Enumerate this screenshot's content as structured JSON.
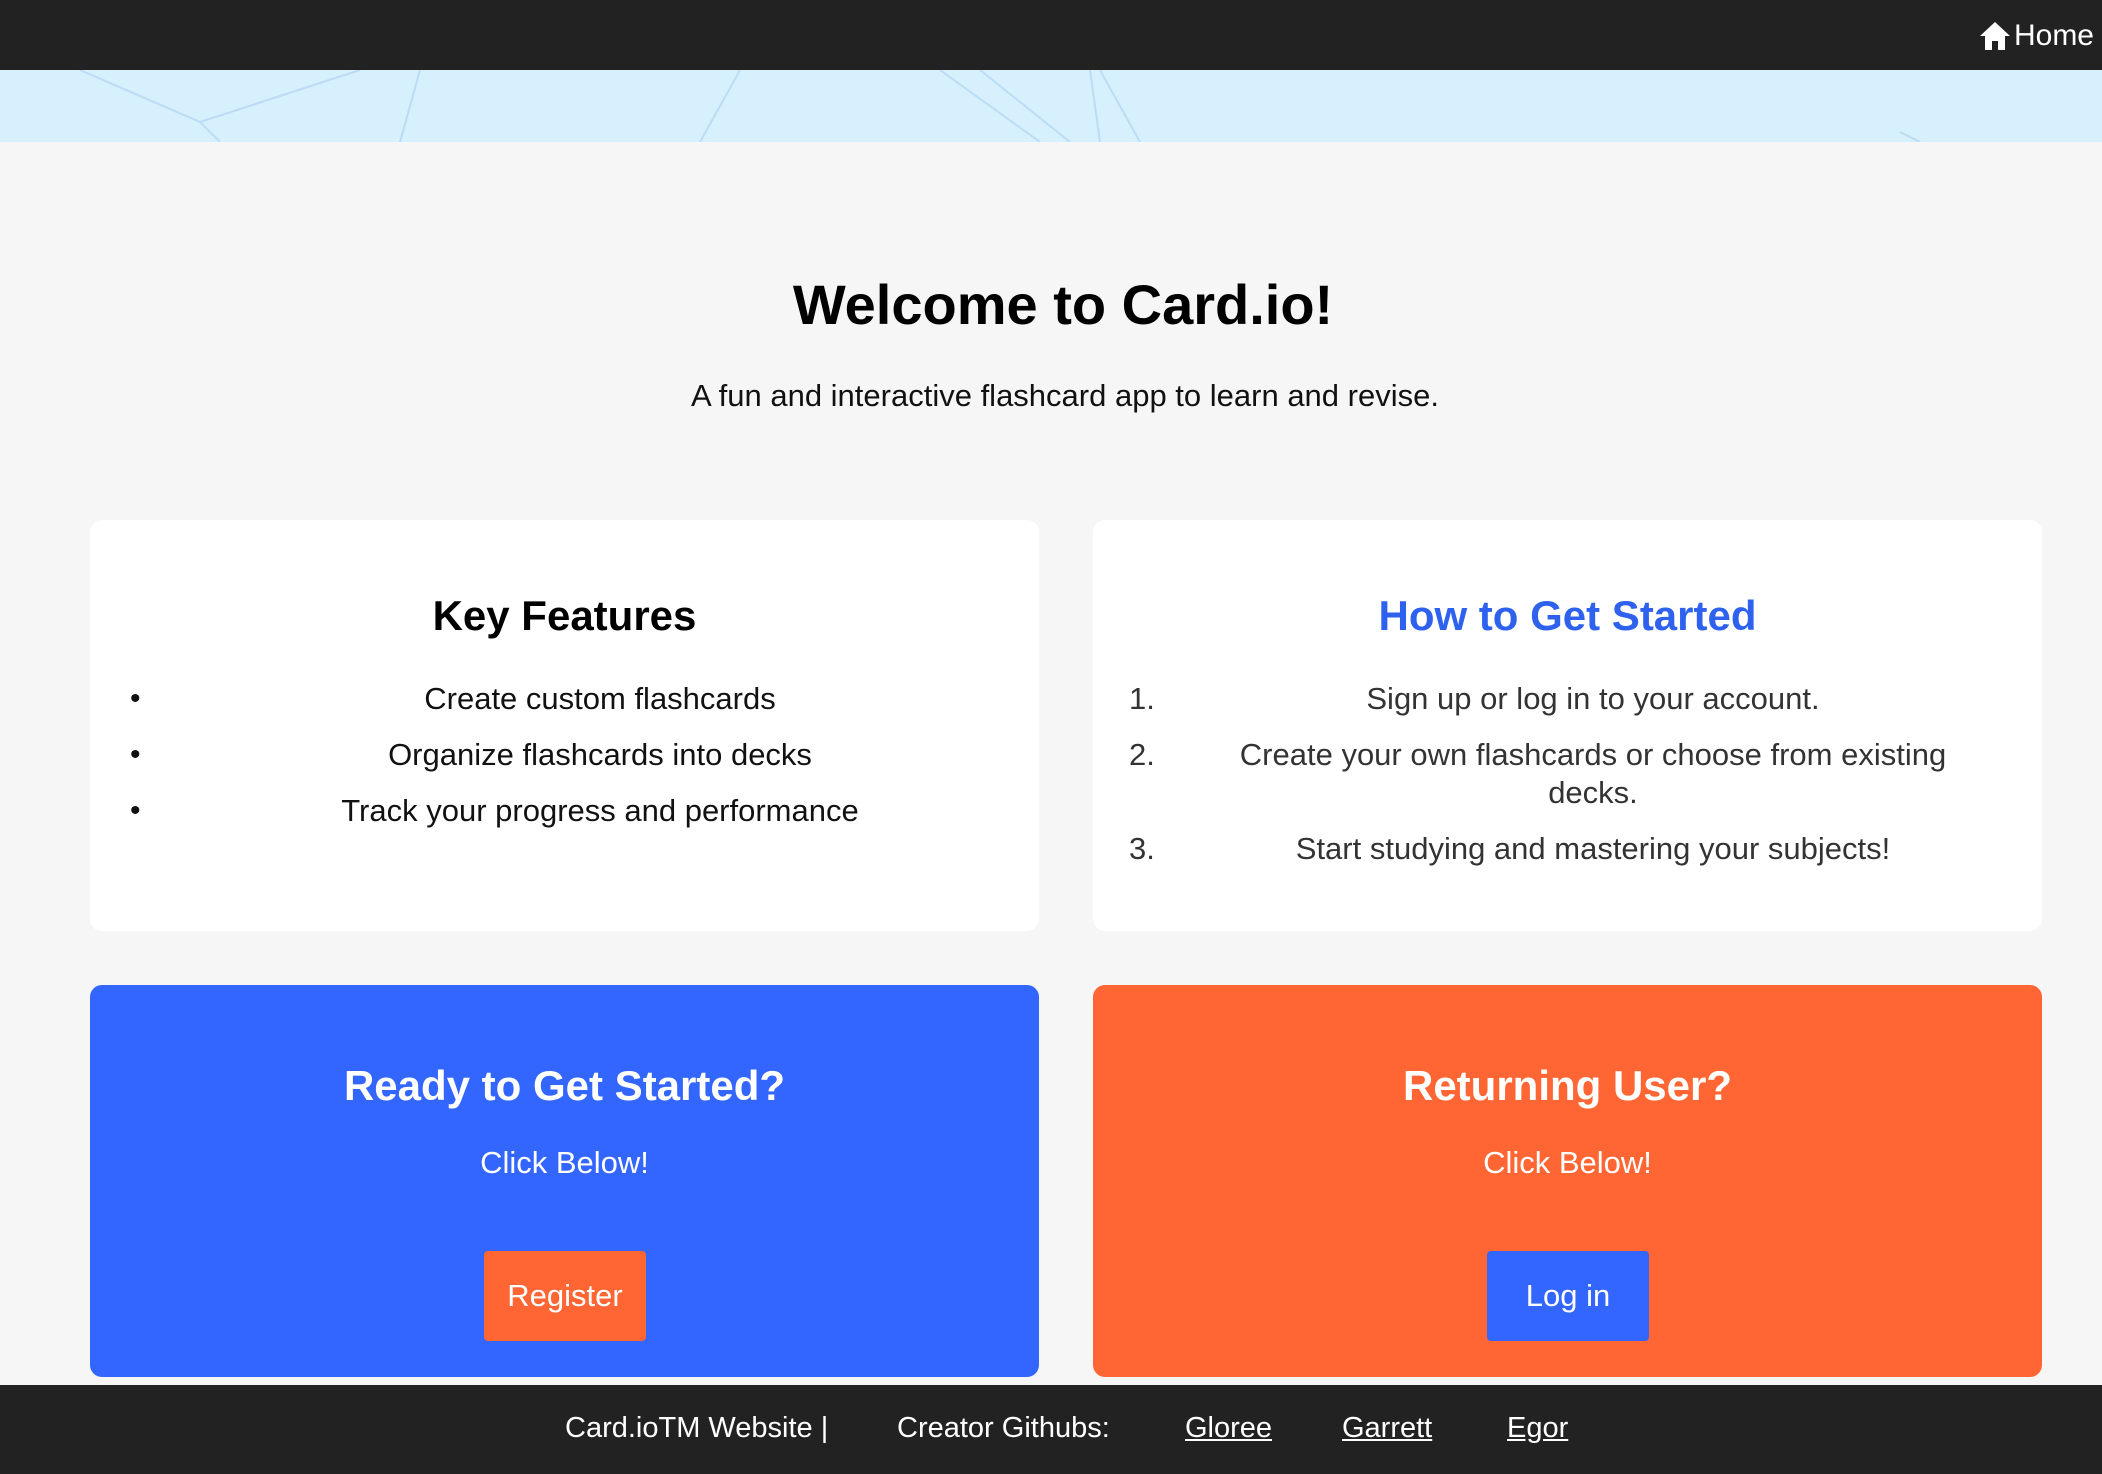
{
  "nav": {
    "home_label": "Home",
    "home_icon": "home-icon"
  },
  "hero": {
    "title": "Welcome to Card.io!",
    "subtitle": "A fun and interactive flashcard app to learn and revise."
  },
  "features": {
    "title": "Key Features",
    "items": [
      "Create custom flashcards",
      "Organize flashcards into decks",
      "Track your progress and performance"
    ]
  },
  "how_to": {
    "title": "How to Get Started",
    "steps": [
      {
        "marker": "1.",
        "text": "Sign up or log in to your account."
      },
      {
        "marker": "2.",
        "text": "Create your own flashcards or choose from existing decks."
      },
      {
        "marker": "3.",
        "text": "Start studying and mastering your subjects!"
      }
    ]
  },
  "register_cta": {
    "title": "Ready to Get Started?",
    "subtitle": "Click Below!",
    "button_label": "Register"
  },
  "login_cta": {
    "title": "Returning User?",
    "subtitle": "Click Below!",
    "button_label": "Log in"
  },
  "footer": {
    "brand_text": "Card.ioTM Website |",
    "creators_label": "Creator Githubs:",
    "links": [
      "Gloree",
      "Garrett",
      "Egor"
    ]
  },
  "colors": {
    "topbar": "#222222",
    "page_bg": "#f6f6f6",
    "hero_strip": "#d6f0fd",
    "accent_blue": "#3366ff",
    "accent_orange": "#ff6633",
    "howto_title": "#2e62ee"
  }
}
